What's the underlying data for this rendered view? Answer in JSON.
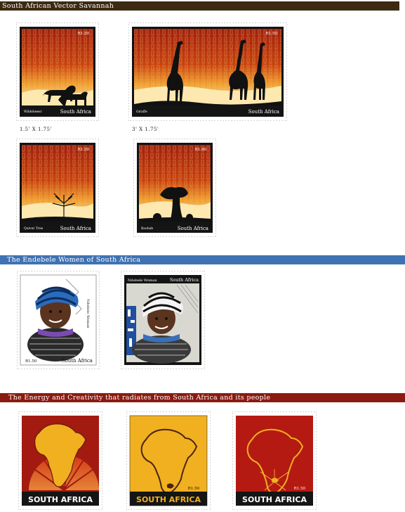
{
  "sections": [
    {
      "title": "South African Vector Savannah",
      "color": "#3c2a12"
    },
    {
      "title": "The Endebele Women of South Africa",
      "color": "#3f72b3"
    },
    {
      "title": "The Energy and Creativity that radiates from South Africa and its people",
      "color": "#8b1a10"
    }
  ],
  "savannah": {
    "wildebeest": {
      "value": "R1.50",
      "label": "Wildebeest",
      "country": "South Africa"
    },
    "giraffe": {
      "value": "R1.50",
      "label": "Giraffe",
      "country": "South Africa"
    },
    "quiver": {
      "value": "R1.50",
      "label": "Quiver Tree",
      "country": "South Africa"
    },
    "baobab": {
      "value": "R1.40",
      "label": "Baobab",
      "country": "South Africa"
    },
    "size_small": "1.5' X 1.75'",
    "size_large": "3' X 1.75'"
  },
  "endebele": {
    "stamp1": {
      "value": "R1.50",
      "country": "South Africa",
      "label": "Ndebele Woman"
    },
    "stamp2": {
      "value": "",
      "country": "South Africa",
      "label": "Ndebele Woman"
    }
  },
  "energy": {
    "stamp1": {
      "country": "SOUTH AFRICA"
    },
    "stamp2": {
      "value": "R1.50",
      "country": "SOUTH AFRICA"
    },
    "stamp3": {
      "value": "R1.50",
      "country": "SOUTH AFRICA"
    }
  }
}
